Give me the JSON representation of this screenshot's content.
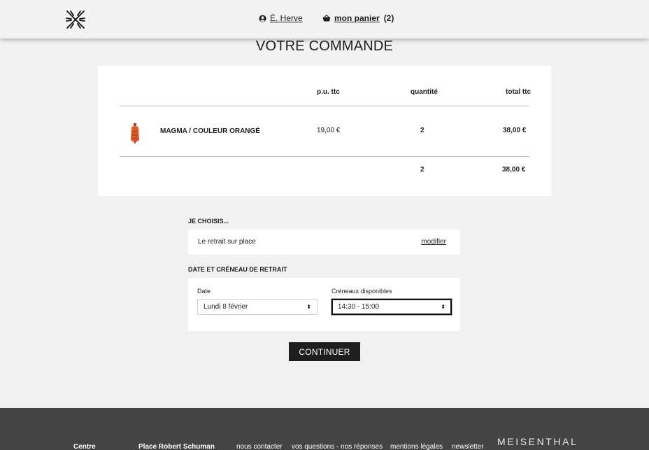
{
  "header": {
    "logo_icon": "snowflake-cross-logo",
    "user_icon": "user-circle-icon",
    "user_name": "É. Herve",
    "cart_icon": "basket-icon",
    "cart_label": "mon panier",
    "cart_count": "(2)"
  },
  "page_title": "VOTRE COMMANDE",
  "order_table": {
    "columns": {
      "unit_price": "p.u. ttc",
      "quantity": "quantité",
      "total": "total ttc"
    },
    "rows": [
      {
        "product": "MAGMA / COULEUR ORANGÉ",
        "unit_price": "19,00 €",
        "quantity": "2",
        "total": "38,00 €"
      }
    ],
    "summary": {
      "quantity": "2",
      "total": "38,00 €"
    }
  },
  "choice": {
    "label": "JE CHOISIS...",
    "pickup_text": "Le retrait sur place",
    "modify_label": "modifier"
  },
  "slot": {
    "label": "DATE ET CRÉNEAU DE RETRAIT",
    "date_label": "Date",
    "date_value": "Lundi 8 février",
    "slot_label": "Créneaux disponibles",
    "slot_value": "14:30 - 15:00"
  },
  "continue_label": "CONTINUER",
  "footer": {
    "col1": "Centre",
    "col2": "Place Robert Schuman",
    "links": [
      "nous contacter",
      "vos questions - nos réponses",
      "mentions légales",
      "newsletter"
    ],
    "brand": "MEISENTHAL"
  },
  "colors": {
    "dark": "#1e1e1e",
    "footer_bg": "#444444",
    "product_accent": "#e0592a"
  }
}
